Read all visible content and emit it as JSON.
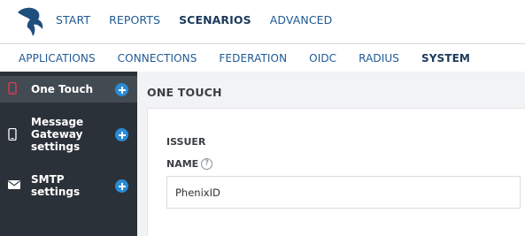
{
  "topnav": {
    "items": [
      {
        "label": "START"
      },
      {
        "label": "REPORTS"
      },
      {
        "label": "SCENARIOS"
      },
      {
        "label": "ADVANCED"
      }
    ]
  },
  "subnav": {
    "items": [
      {
        "label": "APPLICATIONS"
      },
      {
        "label": "CONNECTIONS"
      },
      {
        "label": "FEDERATION"
      },
      {
        "label": "OIDC"
      },
      {
        "label": "RADIUS"
      },
      {
        "label": "SYSTEM"
      }
    ]
  },
  "sidebar": {
    "items": [
      {
        "label": "One Touch",
        "icon": "phone-icon"
      },
      {
        "label": "Message Gateway settings",
        "icon": "phone-icon"
      },
      {
        "label": "SMTP settings",
        "icon": "envelope-icon"
      }
    ]
  },
  "main": {
    "title": "ONE TOUCH",
    "issuer_label": "ISSUER",
    "name_label": "NAME",
    "help_symbol": "?",
    "name_value": "PhenixID"
  },
  "colors": {
    "accent": "#2a8bd6",
    "sidebar_bg": "#2b3138",
    "sidebar_active_bg": "#424a52",
    "nav_link": "#1f5a94",
    "alert_icon": "#e8394f"
  }
}
